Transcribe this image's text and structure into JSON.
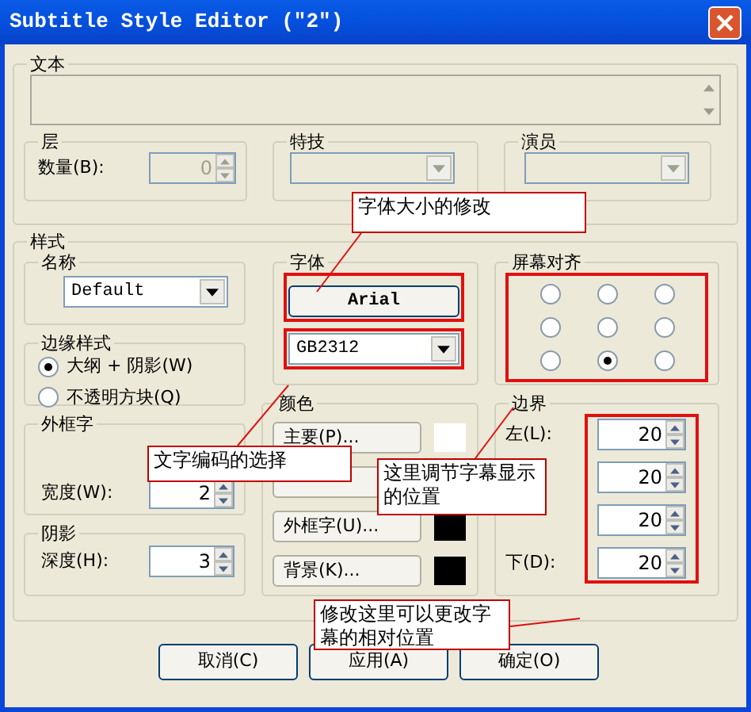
{
  "window": {
    "title": "Subtitle Style Editor (\"2\")"
  },
  "text_group": {
    "label": "文本"
  },
  "layer": {
    "label": "层",
    "field_label": "数量(B):",
    "value": "0",
    "disabled": true
  },
  "effect": {
    "label": "特技",
    "disabled": true
  },
  "actor": {
    "label": "演员",
    "disabled": true
  },
  "style": {
    "label": "样式",
    "name": {
      "label": "名称",
      "value": "Default"
    },
    "edge": {
      "label": "边缘样式",
      "options": [
        {
          "label": "大纲 + 阴影(W)",
          "selected": true
        },
        {
          "label": "不透明方块(Q)",
          "selected": false
        }
      ]
    },
    "outline": {
      "label": "外框字",
      "field_label": "宽度(W):",
      "value": "2"
    },
    "shadow": {
      "label": "阴影",
      "field_label": "深度(H):",
      "value": "3"
    },
    "font": {
      "label": "字体",
      "button": "Arial",
      "encoding": "GB2312"
    },
    "colors": {
      "label": "颜色",
      "buttons": [
        {
          "label": "主要(P)...",
          "color": "#ffffff"
        },
        {
          "covered": true
        },
        {
          "label": "外框字(U)...",
          "color": "#000000"
        },
        {
          "label": "背景(K)...",
          "color": "#000000"
        }
      ]
    },
    "alignment": {
      "label": "屏幕对齐",
      "cells": [
        {
          "selected": false
        },
        {
          "selected": false
        },
        {
          "selected": false
        },
        {
          "selected": false
        },
        {
          "selected": false
        },
        {
          "selected": false
        },
        {
          "selected": false
        },
        {
          "selected": true
        },
        {
          "selected": false
        }
      ]
    },
    "margins": {
      "label": "边界",
      "rows": [
        {
          "label": "左(L):",
          "value": "20"
        },
        {
          "value": "20"
        },
        {
          "value": "20"
        },
        {
          "label": "下(D):",
          "value": "20"
        }
      ]
    }
  },
  "buttons": [
    "取消(C)",
    "应用(A)",
    "确定(O)"
  ],
  "callouts": [
    {
      "text": "字体大小的修改"
    },
    {
      "text": "文字编码的选择"
    },
    {
      "text": "这里调节字幕显示的位置"
    },
    {
      "text": "修改这里可以更改字幕的相对位置"
    }
  ]
}
